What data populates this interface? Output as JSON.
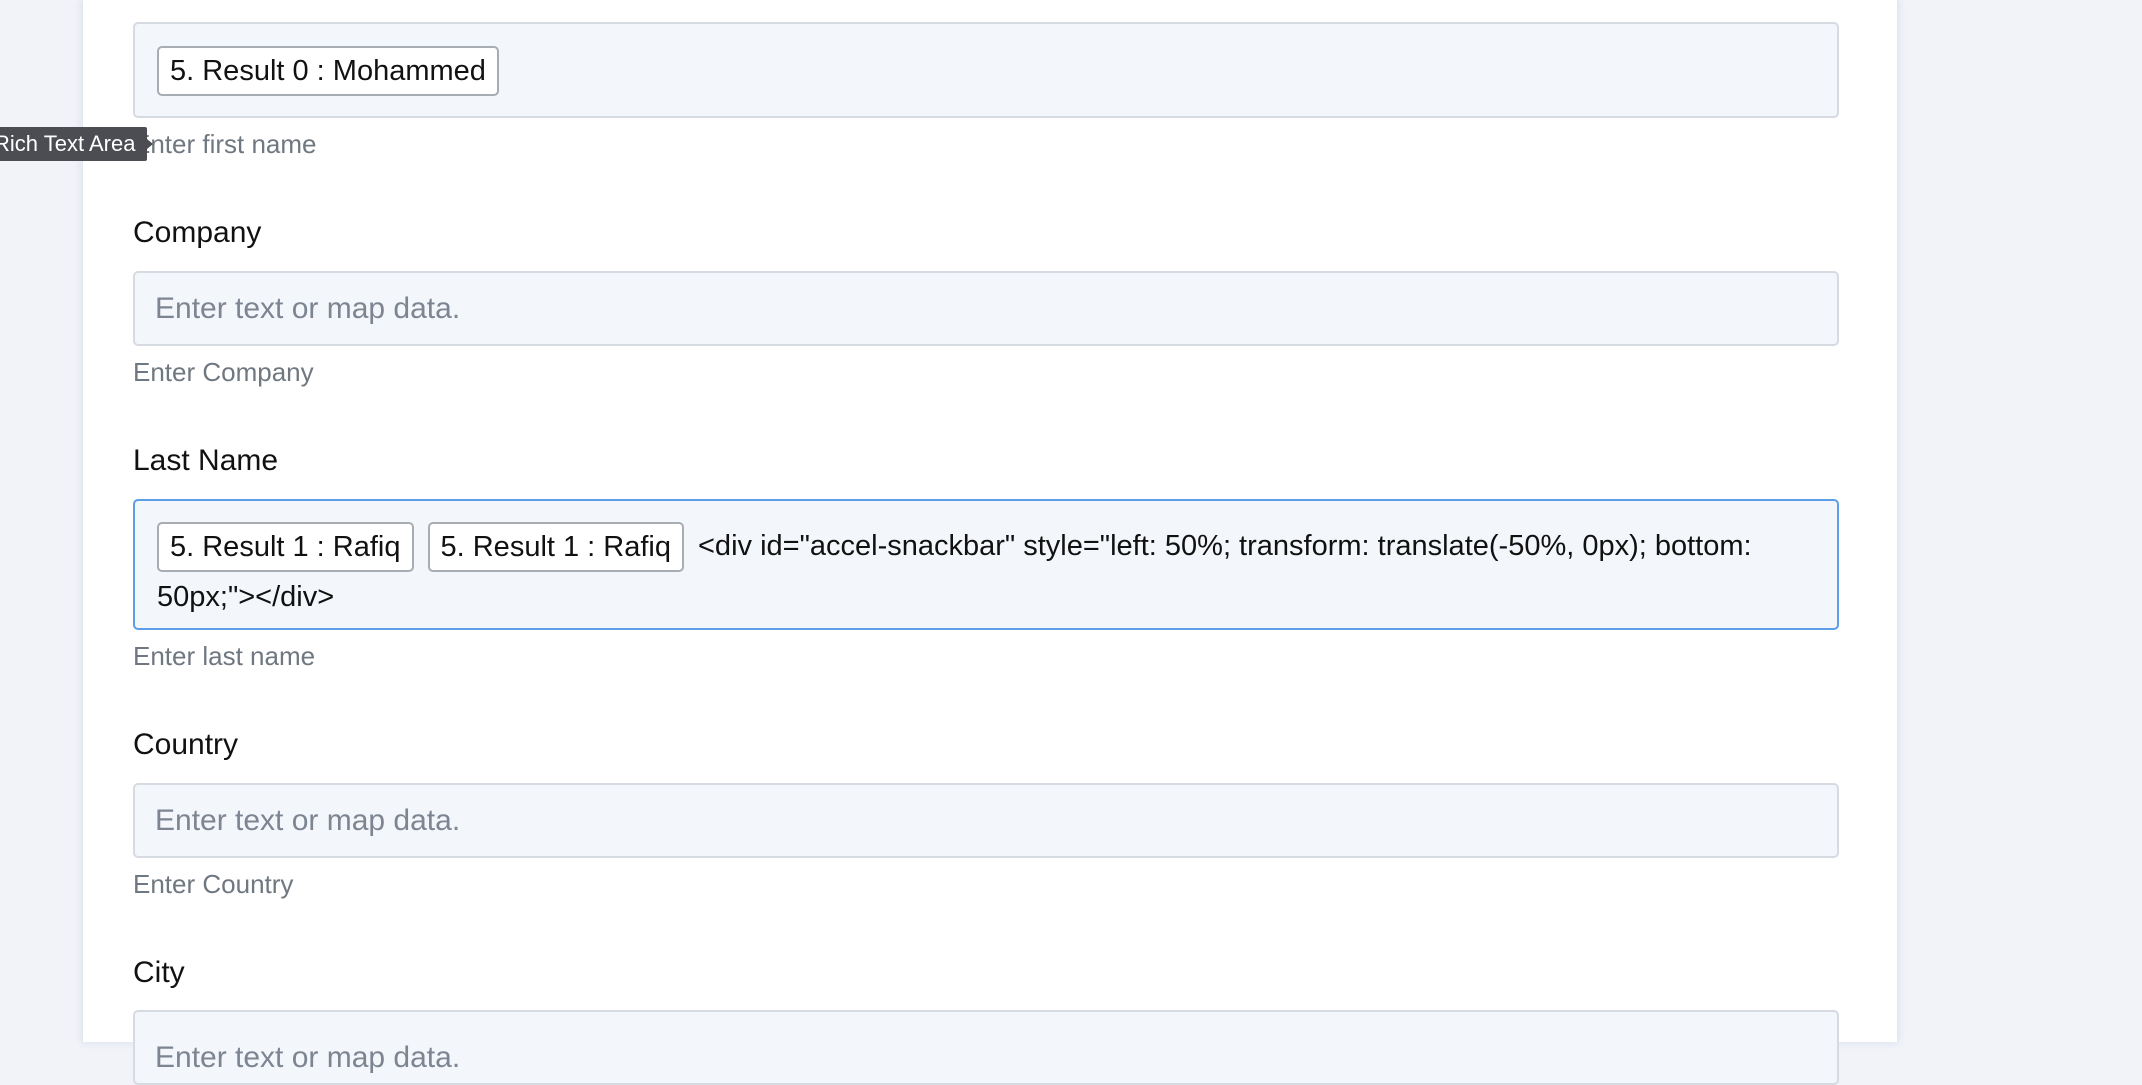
{
  "tooltip": {
    "text": "Rich Text Area"
  },
  "fields": {
    "first_name": {
      "chips": [
        "5. Result 0 : Mohammed"
      ],
      "hint": "Enter first name"
    },
    "company": {
      "label": "Company",
      "placeholder": "Enter text or map data.",
      "hint": "Enter Company"
    },
    "last_name": {
      "label": "Last Name",
      "chips": [
        "5. Result 1 : Rafiq",
        "5. Result 1 : Rafiq"
      ],
      "raw_text": "<div id=\"accel-snackbar\" style=\"left: 50%; transform: translate(-50%, 0px); bottom: 50px;\"></div>",
      "hint": "Enter last name"
    },
    "country": {
      "label": "Country",
      "placeholder": "Enter text or map data.",
      "hint": "Enter Country"
    },
    "city": {
      "label": "City",
      "placeholder": "Enter text or map data."
    }
  },
  "colors": {
    "page_bg": "#f1f3f9",
    "field_bg": "#f3f6fa",
    "field_border": "#d6dbe2",
    "focus_border": "#5d9fe6",
    "hint_text": "#6f7780"
  }
}
